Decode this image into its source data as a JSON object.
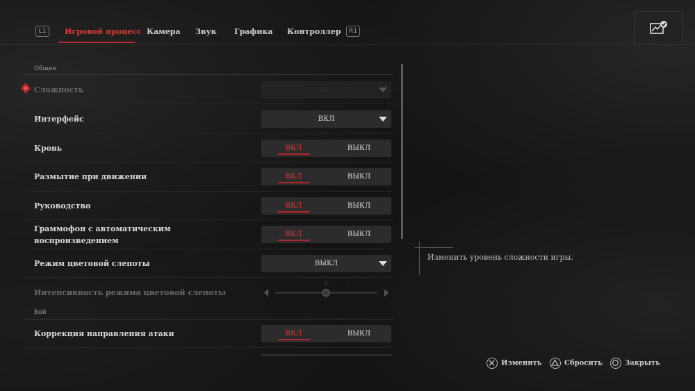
{
  "header": {
    "left_bumper": "L1",
    "right_bumper": "R1",
    "tabs": [
      {
        "label": "Игровой процесс",
        "active": true
      },
      {
        "label": "Камера",
        "active": false
      },
      {
        "label": "Звук",
        "active": false
      },
      {
        "label": "Графика",
        "active": false
      },
      {
        "label": "Контроллер",
        "active": false
      }
    ],
    "corner_icon": "performance-check-icon"
  },
  "sections": {
    "general": "Общее",
    "combat": "Бой"
  },
  "settings": [
    {
      "label": "Сложность",
      "type": "dropdown",
      "value": "-",
      "disabled": true
    },
    {
      "label": "Интерфейс",
      "type": "dropdown",
      "value": "ВКЛ"
    },
    {
      "label": "Кровь",
      "type": "toggle",
      "on": "ВКЛ",
      "off": "ВЫКЛ"
    },
    {
      "label": "Размытие при движении",
      "type": "toggle",
      "on": "ВКЛ",
      "off": "ВЫКЛ"
    },
    {
      "label": "Руководство",
      "type": "toggle",
      "on": "ВКЛ",
      "off": "ВЫКЛ"
    },
    {
      "label": "Граммофон с автоматическим воспроизведением",
      "type": "toggle",
      "on": "ВКЛ",
      "off": "ВЫКЛ"
    },
    {
      "label": "Режим цветовой слепоты",
      "type": "dropdown",
      "value": "ВЫКЛ"
    },
    {
      "label": "Интенсивность режима цветовой слепоты",
      "type": "slider",
      "value": "5",
      "disabled": true
    },
    {
      "label": "Коррекция направления атаки",
      "type": "toggle",
      "on": "ВКЛ",
      "off": "ВЫКЛ"
    }
  ],
  "description": "Изменить уровень сложности игры.",
  "footer": [
    {
      "icon": "cross-button-icon",
      "label": "Изменить"
    },
    {
      "icon": "triangle-button-icon",
      "label": "Сбросить"
    },
    {
      "icon": "circle-button-icon",
      "label": "Закрыть"
    }
  ],
  "colors": {
    "accent": "#e0373a",
    "background": "#141414",
    "control": "#2c2c2c"
  }
}
